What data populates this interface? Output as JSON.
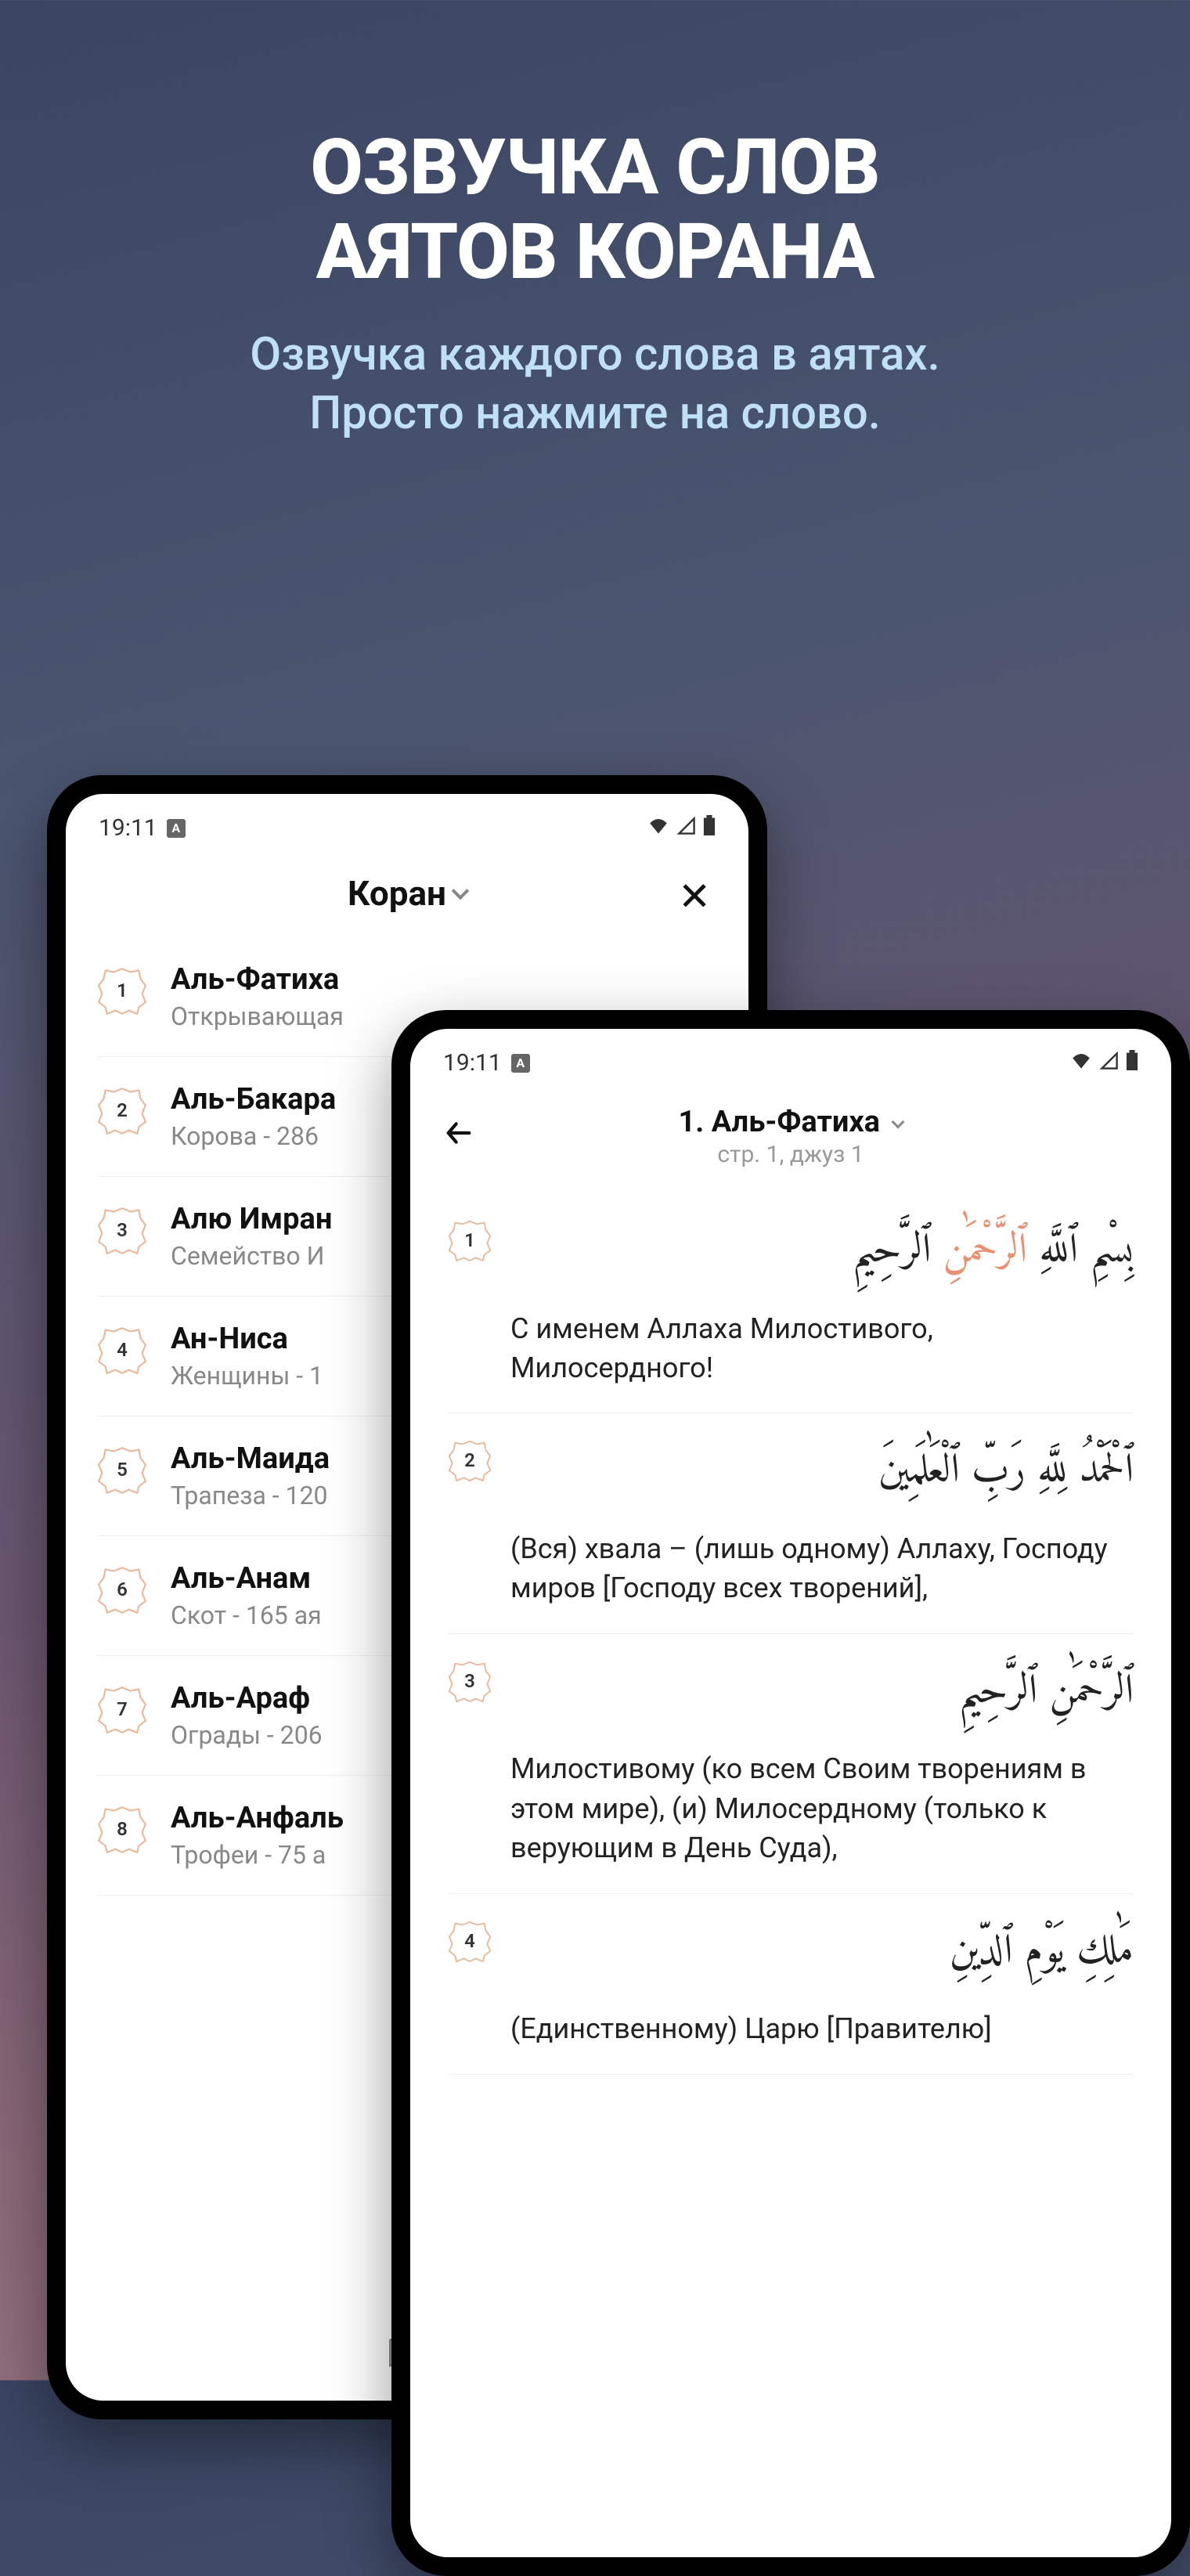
{
  "hero": {
    "title_line1": "ОЗВУЧКА СЛОВ",
    "title_line2": "АЯТОВ КОРАНА",
    "subtitle_line1": "Озвучка каждого слова в аятах.",
    "subtitle_line2": "Просто нажмите на слово."
  },
  "statusbar": {
    "time": "19:11"
  },
  "phone_back": {
    "header_title": "Коран",
    "surahs": [
      {
        "num": "1",
        "name": "Аль-Фатиха",
        "desc": "Открывающая"
      },
      {
        "num": "2",
        "name": "Аль-Бакара",
        "desc": "Корова - 286"
      },
      {
        "num": "3",
        "name": "Алю Имран",
        "desc": "Семейство И"
      },
      {
        "num": "4",
        "name": "Ан-Ниса",
        "desc": "Женщины - 1"
      },
      {
        "num": "5",
        "name": "Аль-Маида",
        "desc": "Трапеза - 120"
      },
      {
        "num": "6",
        "name": "Аль-Анам",
        "desc": "Скот - 165 ая"
      },
      {
        "num": "7",
        "name": "Аль-Араф",
        "desc": "Ограды - 206"
      },
      {
        "num": "8",
        "name": "Аль-Анфаль",
        "desc": "Трофеи - 75 а"
      }
    ]
  },
  "phone_front": {
    "header_title": "1. Аль-Фатиха",
    "header_sub": "стр. 1, джуз 1",
    "ayat": [
      {
        "num": "1",
        "arabic_pre": "بِسْمِ ٱللَّهِ ",
        "arabic_hl": "ٱلرَّحْمَٰنِ",
        "arabic_post": " ٱلرَّحِيمِ",
        "translation": "С именем Аллаха Милостивого, Милосердного!"
      },
      {
        "num": "2",
        "arabic_pre": "ٱلْحَمْدُ لِلَّهِ رَبِّ ٱلْعَٰلَمِينَ",
        "arabic_hl": "",
        "arabic_post": "",
        "translation": "(Вся) хвала – (лишь одному) Аллаху, Господу миров [Господу всех творений],"
      },
      {
        "num": "3",
        "arabic_pre": "ٱلرَّحْمَٰنِ ٱلرَّحِيمِ",
        "arabic_hl": "",
        "arabic_post": "",
        "translation": "Милостивому (ко всем Своим творениям в этом мире), (и) Милосердному (только к верующим в День Суда),"
      },
      {
        "num": "4",
        "arabic_pre": "مَٰلِكِ يَوْمِ ٱلدِّينِ",
        "arabic_hl": "",
        "arabic_post": "",
        "translation": "(Единственному) Царю [Правителю]"
      }
    ]
  }
}
